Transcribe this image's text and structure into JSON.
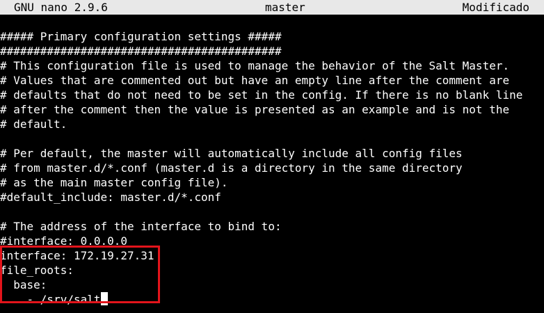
{
  "titlebar": {
    "app": "GNU nano 2.9.6",
    "filename": "master",
    "status": "Modificado",
    "background": "#e8e8e8"
  },
  "editor": {
    "lines": [
      "##### Primary configuration settings #####",
      "##########################################",
      "# This configuration file is used to manage the behavior of the Salt Master.",
      "# Values that are commented out but have an empty line after the comment are",
      "# defaults that do not need to be set in the config. If there is no blank line",
      "# after the comment then the value is presented as an example and is not the",
      "# default.",
      "",
      "# Per default, the master will automatically include all config files",
      "# from master.d/*.conf (master.d is a directory in the same directory",
      "# as the main master config file).",
      "#default_include: master.d/*.conf",
      "",
      "# The address of the interface to bind to:",
      "#interface: 0.0.0.0",
      "interface: 172.19.27.31",
      "file_roots:",
      "  base:",
      "    - /srv/salt"
    ]
  },
  "annotation": {
    "color": "#e3141b"
  }
}
